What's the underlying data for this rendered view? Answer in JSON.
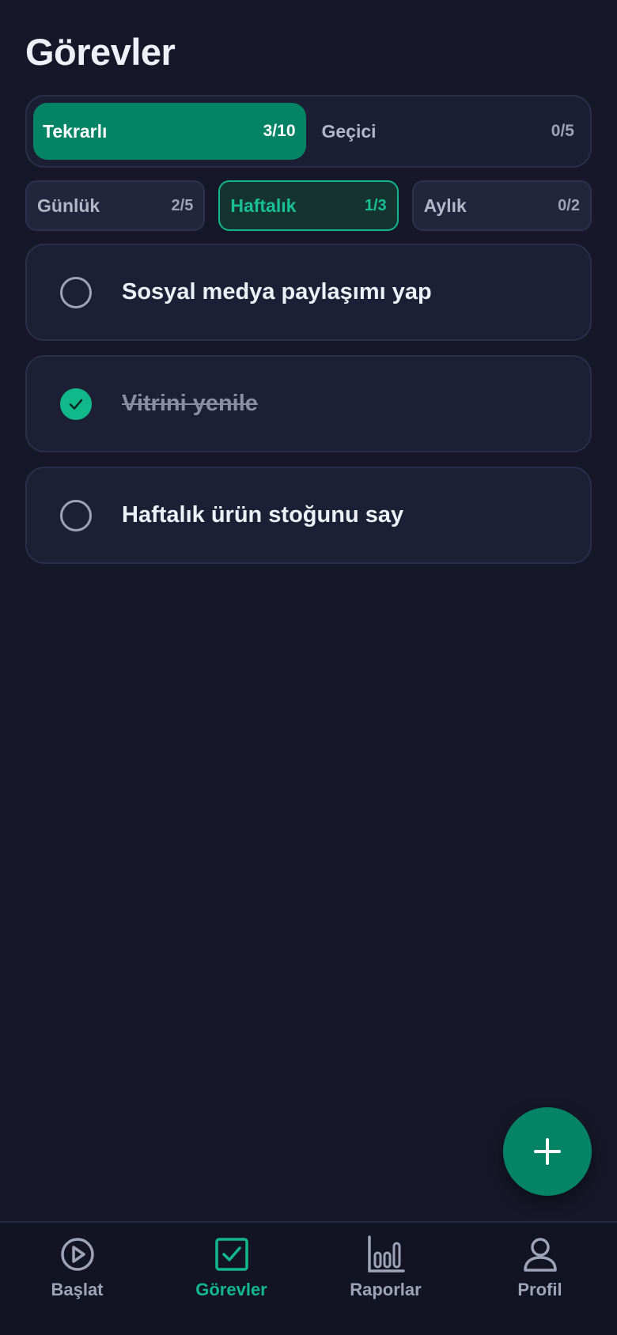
{
  "page": {
    "title": "Görevler"
  },
  "task_type_tabs": [
    {
      "label": "Tekrarlı",
      "count": "3/10",
      "active": true
    },
    {
      "label": "Geçici",
      "count": "0/5",
      "active": false
    }
  ],
  "period_chips": [
    {
      "label": "Günlük",
      "count": "2/5",
      "active": false
    },
    {
      "label": "Haftalık",
      "count": "1/3",
      "active": true
    },
    {
      "label": "Aylık",
      "count": "0/2",
      "active": false
    }
  ],
  "tasks": [
    {
      "title": "Sosyal medya paylaşımı yap",
      "done": false
    },
    {
      "title": "Vitrini yenile",
      "done": true
    },
    {
      "title": "Haftalık ürün stoğunu say",
      "done": false
    }
  ],
  "fab": {
    "icon": "plus-icon"
  },
  "bottom_nav": [
    {
      "label": "Başlat",
      "icon": "play-circle-icon",
      "active": false
    },
    {
      "label": "Görevler",
      "icon": "checkbox-icon",
      "active": true
    },
    {
      "label": "Raporlar",
      "icon": "bar-chart-icon",
      "active": false
    },
    {
      "label": "Profil",
      "icon": "user-icon",
      "active": false
    }
  ],
  "colors": {
    "background": "#161829",
    "accent": "#048465",
    "accent_bright": "#12b88c",
    "card": "#1d1f34"
  }
}
